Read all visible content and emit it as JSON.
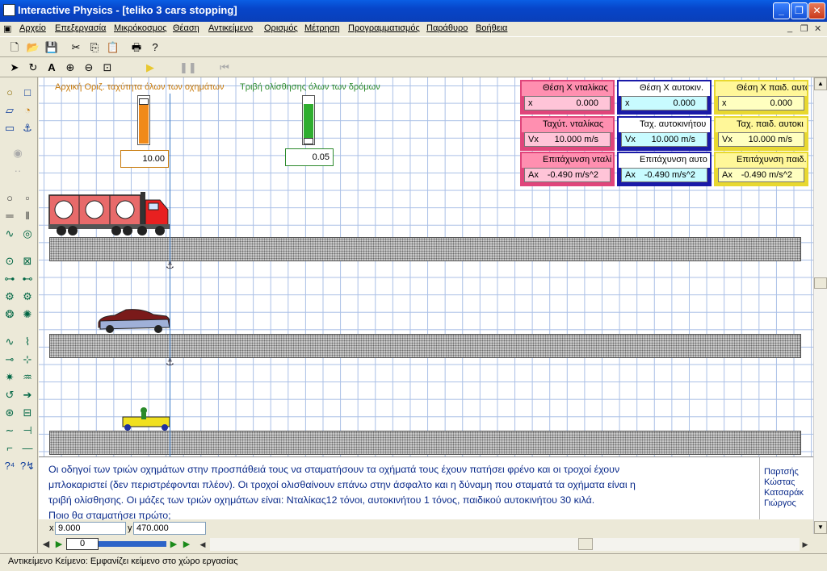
{
  "window": {
    "title": "Interactive Physics - [teliko 3 cars stopping]"
  },
  "menu": [
    "Αρχείο",
    "Επεξεργασία",
    "Μικρόκοσμος",
    "Θέαση",
    "Αντικείμενο",
    "Ορισμός",
    "Μέτρηση",
    "Προγραμματισμός",
    "Παράθυρο",
    "Βοήθεια"
  ],
  "workspace": {
    "hint_speed": "Αρχική Οριζ. ταχύτητα όλων των οχημάτων",
    "hint_friction": "Τριβή ολίσθησης όλων των δρόμων",
    "speed_value": "10.00",
    "friction_value": "0.05",
    "speed_level": 0.85,
    "friction_level": 0.85
  },
  "meters": [
    {
      "title": "Θέση Χ νταλίκας",
      "label": "x",
      "value": "0.000",
      "color": "#e0457b"
    },
    {
      "title": "Θέση Χ αυτοκιν.",
      "label": "x",
      "value": "0.000",
      "color": "#1a1aa8"
    },
    {
      "title": "Θέση Χ παιδ. αυτο",
      "label": "x",
      "value": "0.000",
      "color": "#e8d830"
    },
    {
      "title": "Ταχύτ. νταλίκας",
      "label": "Vx",
      "value": "10.000 m/s",
      "color": "#e0457b"
    },
    {
      "title": "Ταχ. αυτοκινήτου",
      "label": "Vx",
      "value": "10.000 m/s",
      "color": "#1a1aa8"
    },
    {
      "title": "Ταχ. παιδ. αυτοκι",
      "label": "Vx",
      "value": "10.000 m/s",
      "color": "#e8d830"
    },
    {
      "title": "Επιτάχυνση νταλί",
      "label": "Ax",
      "value": "-0.490 m/s^2",
      "color": "#e0457b"
    },
    {
      "title": "Επιτάχυνση αυτο",
      "label": "Ax",
      "value": "-0.490 m/s^2",
      "color": "#1a1aa8"
    },
    {
      "title": "Επιτάχυνση παιδ.",
      "label": "Ax",
      "value": "-0.490 m/s^2",
      "color": "#e8d830"
    }
  ],
  "text_pane": {
    "line1": "Οι οδηγοί των τριών οχημάτων στην προσπάθειά τους να σταματήσουν τα οχήματά τους έχουν πατήσει φρένο και οι τροχοί έχουν",
    "line2": "μπλοκαριστεί (δεν περιστρέφονται πλέον). Οι τροχοί ολισθαίνουν επάνω στην άσφαλτο και η δύναμη που σταματά τα οχήματα είναι η",
    "line3": "τριβή ολίσθησης. Οι μάζες των τριών οχημάτων είναι: Νταλίκας12 τόνοι, αυτοκινήτου 1 τόνος, παιδικού αυτοκινήτου 30 κιλά.",
    "line4": "Ποιο θα σταματήσει πρώτο;"
  },
  "side_pane": {
    "l1": "Παρτσής",
    "l2": "Κώστας",
    "l3": "Κατσαράκ",
    "l4": "Γιώργος"
  },
  "coords": {
    "x_label": "x",
    "x_value": "9.000",
    "y_label": "y",
    "y_value": "470.000"
  },
  "playback": {
    "frame": "0"
  },
  "status": "Αντικείμενο Κείμενο:  Εμφανίζει κείμενο στο χώρο εργασίας"
}
